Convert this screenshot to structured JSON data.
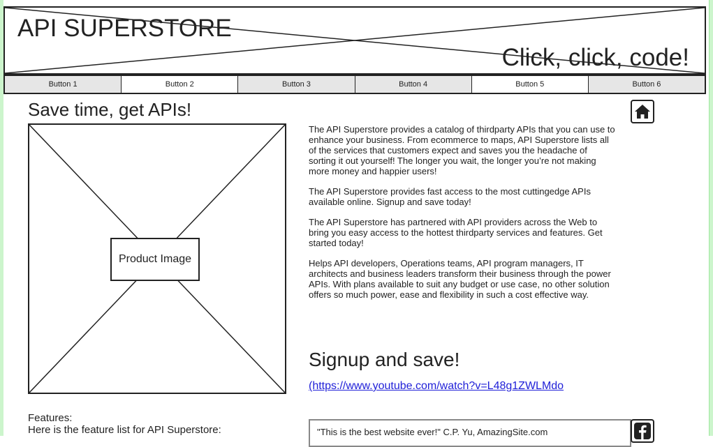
{
  "banner": {
    "title": "API SUPERSTORE",
    "slogan": "Click, click, code!"
  },
  "nav": {
    "buttons": [
      {
        "label": "Button 1",
        "active": false
      },
      {
        "label": "Button 2",
        "active": true
      },
      {
        "label": "Button 3",
        "active": false
      },
      {
        "label": "Button 4",
        "active": false
      },
      {
        "label": "Button 5",
        "active": true
      },
      {
        "label": "Button 6",
        "active": false
      }
    ]
  },
  "home_icon": "home-icon",
  "main": {
    "heading": "Save time, get APIs!",
    "image_label": "Product Image",
    "paragraphs": [
      "The API Superstore provides a catalog of thirdparty APIs that you can use to enhance your business. From ecommerce to maps, API Superstore lists all of the services that customers expect and saves you the headache of sorting it out yourself! The longer you wait, the longer you’re not making more money and happier users!",
      "The API Superstore provides fast access to the most cuttingedge APIs available online. Signup and save today!",
      "The API Superstore has partnered with API providers across the Web to bring you easy access to the hottest thirdparty services and features. Get started today!",
      "Helps API developers, Operations teams, API program managers, IT architects and business leaders transform their business through the power APIs. With plans available to suit any budget or use case, no other solution offers so much power, ease and flexibility in such a cost effective way."
    ],
    "signup_heading": "Signup and save!",
    "signup_link": "(https://www.youtube.com/watch?v=L48g1ZWLMdo",
    "features_label": "Features:",
    "features_desc": "Here is the feature list for API Superstore:",
    "testimonial": "\"This is the best website ever!\"  C.P. Yu, AmazingSite.com"
  },
  "facebook_icon": "facebook-icon",
  "colors": {
    "stripe": "#ccf5cc",
    "link": "#1f1fd8",
    "nav_bg": "#e6e6e6"
  }
}
